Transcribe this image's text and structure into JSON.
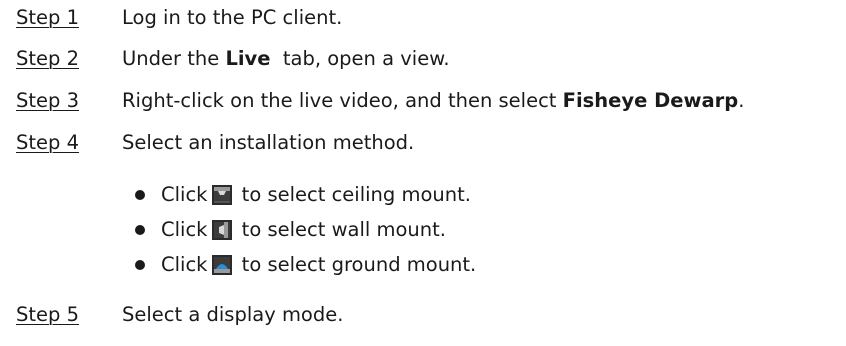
{
  "steps": [
    {
      "label": "Step 1",
      "parts": [
        "Log in to the PC client."
      ]
    },
    {
      "label": "Step 2",
      "parts": [
        "Under the ",
        "Live",
        "  tab, open a view."
      ]
    },
    {
      "label": "Step 3",
      "parts": [
        "Right-click on the live video, and then select ",
        "Fisheye Dewarp",
        "."
      ]
    },
    {
      "label": "Step 4",
      "parts": [
        "Select an installation method."
      ]
    },
    {
      "label": "Step 5",
      "parts": [
        "Select a display mode."
      ]
    }
  ],
  "bullets": [
    {
      "click": "Click",
      "icon": "ceiling-mount-icon",
      "text": " to select ceiling mount."
    },
    {
      "click": "Click",
      "icon": "wall-mount-icon",
      "text": " to select wall mount."
    },
    {
      "click": "Click",
      "icon": "ground-mount-icon",
      "text": " to select ground mount."
    }
  ]
}
